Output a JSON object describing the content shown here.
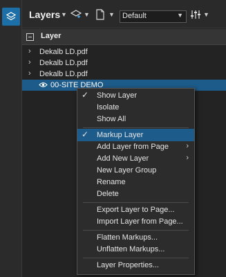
{
  "rail": {
    "icon": "layers-icon"
  },
  "toolbar": {
    "title": "Layers",
    "layer_state_select": {
      "value": "Default"
    },
    "icons": [
      "new-layer-icon",
      "page-icon",
      "settings-sliders-icon"
    ]
  },
  "header": {
    "column_label": "Layer"
  },
  "tree": {
    "items": [
      {
        "label": "Dekalb LD.pdf"
      },
      {
        "label": "Dekalb LD.pdf"
      },
      {
        "label": "Dekalb LD.pdf"
      }
    ],
    "selected": {
      "label": "00-SITE DEMO",
      "icon": "eye-icon"
    }
  },
  "menu": {
    "items": [
      {
        "label": "Show Layer",
        "checked": true
      },
      {
        "label": "Isolate"
      },
      {
        "label": "Show All"
      },
      {
        "label": "Markup Layer",
        "checked": true,
        "highlighted": true
      },
      {
        "label": "Add Layer from Page",
        "submenu": true
      },
      {
        "label": "Add New Layer",
        "submenu": true
      },
      {
        "label": "New Layer Group"
      },
      {
        "label": "Rename"
      },
      {
        "label": "Delete"
      },
      {
        "label": "Export Layer to Page..."
      },
      {
        "label": "Import Layer from Page..."
      },
      {
        "label": "Flatten Markups..."
      },
      {
        "label": "Unflatten Markups..."
      },
      {
        "label": "Layer Properties..."
      }
    ]
  }
}
